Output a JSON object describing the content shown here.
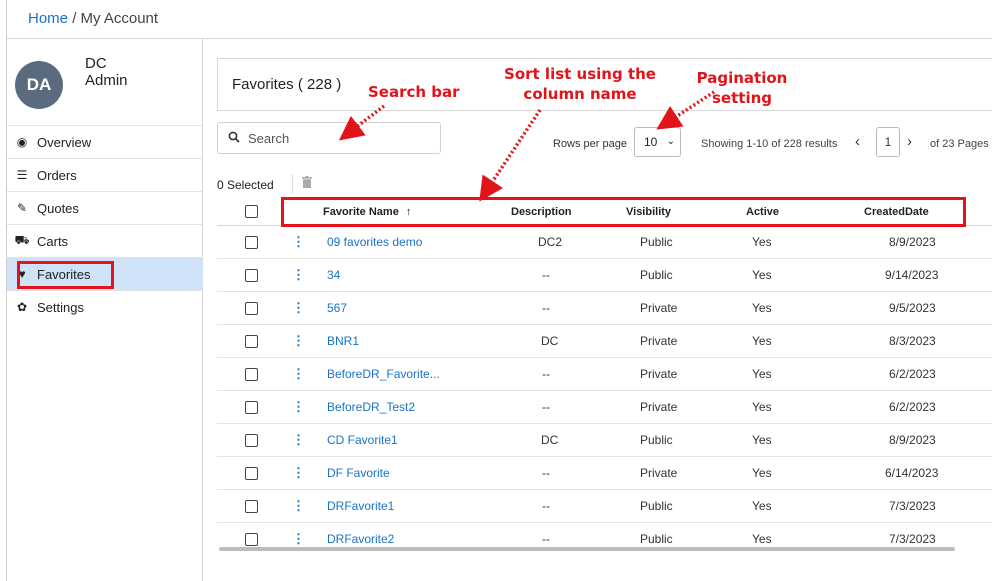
{
  "breadcrumb": {
    "home": "Home",
    "sep": "/",
    "current": "My Account"
  },
  "user": {
    "initials": "DA",
    "line1": "DC",
    "line2": "Admin"
  },
  "nav": [
    {
      "label": "Overview",
      "icon": "dashboard-icon",
      "glyph": "◉"
    },
    {
      "label": "Orders",
      "icon": "list-icon",
      "glyph": "☰"
    },
    {
      "label": "Quotes",
      "icon": "pencil-icon",
      "glyph": "✎"
    },
    {
      "label": "Carts",
      "icon": "cart-icon",
      "glyph": "⛟"
    },
    {
      "label": "Favorites",
      "icon": "heart-icon",
      "glyph": "♥"
    },
    {
      "label": "Settings",
      "icon": "gear-icon",
      "glyph": "✿"
    }
  ],
  "favorites": {
    "title": "Favorites ( 228 )"
  },
  "search": {
    "placeholder": "Search"
  },
  "pagination": {
    "rows_label": "Rows per page",
    "rows_value": "10",
    "showing": "Showing 1-10 of 228 results",
    "page": "1",
    "total": "of 23 Pages"
  },
  "selection": {
    "label": "0 Selected"
  },
  "table": {
    "headers": {
      "name": "Favorite Name",
      "sort_glyph": "↑",
      "description": "Description",
      "visibility": "Visibility",
      "active": "Active",
      "created": "CreatedDate"
    },
    "rows": [
      {
        "name": "09 favorites demo",
        "description": "DC2",
        "visibility": "Public",
        "active": "Yes",
        "created": "8/9/2023"
      },
      {
        "name": "34",
        "description": "--",
        "visibility": "Public",
        "active": "Yes",
        "created": "9/14/2023"
      },
      {
        "name": "567",
        "description": "--",
        "visibility": "Private",
        "active": "Yes",
        "created": "9/5/2023"
      },
      {
        "name": "BNR1",
        "description": "DC",
        "visibility": "Private",
        "active": "Yes",
        "created": "8/3/2023"
      },
      {
        "name": "BeforeDR_Favorite...",
        "description": "--",
        "visibility": "Private",
        "active": "Yes",
        "created": "6/2/2023"
      },
      {
        "name": "BeforeDR_Test2",
        "description": "--",
        "visibility": "Private",
        "active": "Yes",
        "created": "6/2/2023"
      },
      {
        "name": "CD Favorite1",
        "description": "DC",
        "visibility": "Public",
        "active": "Yes",
        "created": "8/9/2023"
      },
      {
        "name": "DF Favorite",
        "description": "--",
        "visibility": "Private",
        "active": "Yes",
        "created": "6/14/2023"
      },
      {
        "name": "DRFavorite1",
        "description": "--",
        "visibility": "Public",
        "active": "Yes",
        "created": "7/3/2023"
      },
      {
        "name": "DRFavorite2",
        "description": "--",
        "visibility": "Public",
        "active": "Yes",
        "created": "7/3/2023"
      }
    ]
  },
  "annotations": {
    "search_bar": "Search bar",
    "sort_list": "Sort list using the column name",
    "pagination": "Pagination setting"
  },
  "colors": {
    "accent": "#1a73c8",
    "annotation": "#e0141a",
    "active_nav": "#cfe2f8",
    "avatar": "#5a6b80"
  }
}
